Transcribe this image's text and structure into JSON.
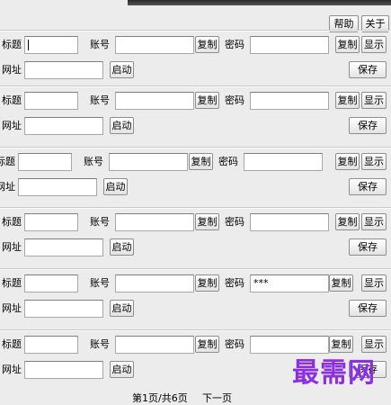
{
  "header": {
    "help_label": "帮助",
    "about_label": "关于"
  },
  "labels": {
    "title": "标题",
    "account": "账号",
    "password": "密码",
    "url": "网址",
    "copy": "复制",
    "show": "显示",
    "launch": "启动",
    "save": "保存"
  },
  "entries": [
    {
      "title": "",
      "account": "",
      "password": "",
      "url": ""
    },
    {
      "title": "",
      "account": "",
      "password": "",
      "url": ""
    },
    {
      "title": "",
      "account": "",
      "password": "",
      "url": ""
    },
    {
      "title": "",
      "account": "",
      "password": "",
      "url": ""
    },
    {
      "title": "",
      "account": "",
      "password": "***",
      "url": ""
    },
    {
      "title": "",
      "account": "",
      "password": "",
      "url": ""
    }
  ],
  "pagination": {
    "page_info": "第1页/共6页",
    "next_label": "下一页"
  },
  "watermark": {
    "text": "最需网"
  }
}
